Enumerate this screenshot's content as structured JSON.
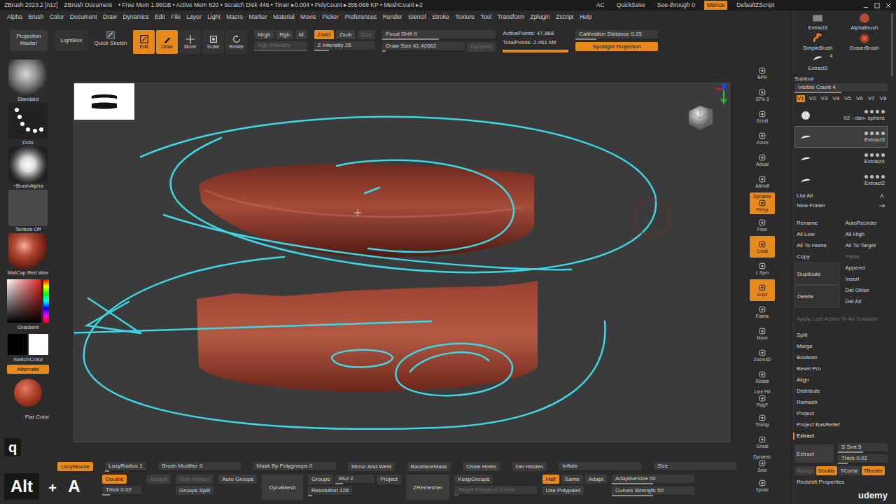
{
  "title_bar": {
    "app": "ZBrush 2023.2 [n1z]",
    "document": "ZBrush Document",
    "stats": "• Free Mem 1.96GB • Active Mem 620 • Scratch Disk 446 • Timer ▸0.004 • PolyCount ▸355.068 KP • MeshCount ▸2",
    "right": [
      {
        "label": "AC",
        "on": false
      },
      {
        "label": "QuickSave",
        "on": false
      },
      {
        "label": "See-through 0",
        "on": false
      },
      {
        "label": "Menus",
        "on": true
      },
      {
        "label": "DefaultZScript",
        "on": false
      }
    ]
  },
  "menu": [
    "Alpha",
    "Brush",
    "Color",
    "Document",
    "Draw",
    "Dynamics",
    "Edit",
    "File",
    "Layer",
    "Light",
    "Macro",
    "Marker",
    "Material",
    "Movie",
    "Picker",
    "Preferences",
    "Render",
    "Stencil",
    "Stroke",
    "Texture",
    "Tool",
    "Transform",
    "Zplugin",
    "Zscript",
    "Help"
  ],
  "top_shelf": {
    "projection_master": "Projection Master",
    "lightbox": "LightBox",
    "quick_sketch": "Quick Sketch",
    "modes": [
      {
        "label": "Edit",
        "on": true
      },
      {
        "label": "Draw",
        "on": true
      },
      {
        "label": "Move",
        "on": false
      },
      {
        "label": "Scale",
        "on": false
      },
      {
        "label": "Rotate",
        "on": false
      }
    ],
    "color_modes": [
      {
        "label": "Mrgb",
        "on": false
      },
      {
        "label": "Rgb",
        "on": false
      },
      {
        "label": "M",
        "on": false
      }
    ],
    "rgb_intensity": {
      "label": "Rgb Intensity",
      "level": 1,
      "disabled": true
    },
    "z_modes": [
      {
        "label": "Zadd",
        "on": true,
        "disabled": false
      },
      {
        "label": "Zsub",
        "on": false,
        "disabled": false
      },
      {
        "label": "Zcut",
        "on": false,
        "disabled": true
      }
    ],
    "z_intensity": {
      "label": "Z Intensity 25",
      "level": 0.25
    },
    "focal_shift": {
      "label": "Focal Shift 0",
      "level": 0.5
    },
    "draw_size": {
      "label": "Draw Size 41.42062",
      "level": 0.04
    },
    "dynamic": {
      "label": "Dynamic",
      "disabled": true
    },
    "active_points": "ActivePoints: 47,868",
    "total_points": "TotalPoints: 2.461 Mil",
    "progress": {
      "level": 1
    },
    "calibration": {
      "label": "Calibration Distance 0.25",
      "level": 0.25
    },
    "spotlight": {
      "label": "Spotlight Projection",
      "on": true
    }
  },
  "left_shelf": {
    "brush": "Standard",
    "stroke": "Dots",
    "alpha": "~BrushAlpha",
    "texture": "Texture Off",
    "material": "MatCap Red Wax",
    "gradient": "Gradient",
    "switch_color": "SwitchColor",
    "alternate": {
      "label": "Alternate",
      "on": true
    },
    "flat_color": "Flat Color"
  },
  "right_shelf": [
    {
      "label": "BPR",
      "on": false
    },
    {
      "label": "SPix 3",
      "on": false
    },
    {
      "label": "Scroll",
      "on": false
    },
    {
      "label": "Zoom",
      "on": false
    },
    {
      "label": "Actual",
      "on": false
    },
    {
      "label": "AAHalf",
      "on": false
    },
    {
      "label": "Persp",
      "on": true,
      "caption": "Dynamic"
    },
    {
      "label": "Floor",
      "on": false
    },
    {
      "label": "Local",
      "on": true
    },
    {
      "label": "L.Sym",
      "on": false
    },
    {
      "label": "Gxyz",
      "on": true
    },
    {
      "label": "Frame",
      "on": false
    },
    {
      "label": "Move",
      "on": false
    },
    {
      "label": "Zoom3D",
      "on": false
    },
    {
      "label": "Rotate",
      "on": false
    },
    {
      "label": "PolyF",
      "on": false,
      "caption": "Line Fill"
    },
    {
      "label": "Transp",
      "on": false
    },
    {
      "label": "Ghost",
      "on": false
    },
    {
      "label": "Solo",
      "on": false,
      "caption": "Dynamic"
    },
    {
      "label": "Xpose",
      "on": false
    }
  ],
  "tray": {
    "brushes": [
      {
        "label": "Extract3"
      },
      {
        "label": "AlphaBrush"
      },
      {
        "label": "SimpleBrush"
      },
      {
        "label": "EraserBrush"
      },
      {
        "label": "Extract3",
        "count": "4"
      }
    ],
    "subtool": {
      "title": "Subtool",
      "visible_count": {
        "label": "Visible Count 4",
        "level": 0.5
      },
      "versions": [
        {
          "label": "V1",
          "selected": true
        },
        {
          "label": "V2",
          "selected": false
        },
        {
          "label": "V3",
          "selected": false
        },
        {
          "label": "V4",
          "selected": false
        },
        {
          "label": "V5",
          "selected": false
        },
        {
          "label": "V6",
          "selected": false
        },
        {
          "label": "V7",
          "selected": false
        },
        {
          "label": "V8",
          "selected": false
        }
      ],
      "items": [
        {
          "name": "02 - dan- sphere",
          "selected": false
        },
        {
          "name": "Extract3",
          "selected": true
        },
        {
          "name": "Extract4",
          "selected": false
        },
        {
          "name": "Extract2",
          "selected": false
        }
      ],
      "list_all": "List All",
      "new_folder": "New Folder",
      "actions_left": [
        {
          "label": "Rename",
          "disabled": false
        },
        {
          "label": "All Low",
          "disabled": false
        },
        {
          "label": "All To Home",
          "disabled": false
        },
        {
          "label": "Copy",
          "disabled": false
        },
        {
          "label": "Duplicate",
          "disabled": false
        },
        {
          "label": "Delete",
          "disabled": false
        }
      ],
      "actions_right": [
        {
          "label": "AutoReorder",
          "disabled": false
        },
        {
          "label": "All High",
          "disabled": false
        },
        {
          "label": "All To Target",
          "disabled": false
        },
        {
          "label": "Paste",
          "disabled": true
        },
        {
          "label": "Append",
          "disabled": false
        },
        {
          "label": "Insert",
          "disabled": false
        },
        {
          "label": "Del Other",
          "disabled": false
        },
        {
          "label": "Del All",
          "disabled": false
        }
      ],
      "apply_all": {
        "label": "Apply Last Action To All Subtools",
        "disabled": true
      },
      "sections": [
        {
          "label": "Split",
          "expanded": false
        },
        {
          "label": "Merge",
          "expanded": false
        },
        {
          "label": "Boolean",
          "expanded": false
        },
        {
          "label": "Bevel Pro",
          "expanded": false
        },
        {
          "label": "Align",
          "expanded": false
        },
        {
          "label": "Distribute",
          "expanded": false
        },
        {
          "label": "Remesh",
          "expanded": false
        },
        {
          "label": "Project",
          "expanded": false
        },
        {
          "label": "Project BasRelief",
          "expanded": false
        },
        {
          "label": "Extract",
          "expanded": true
        }
      ],
      "extract": {
        "button": {
          "label": "Extract"
        },
        "smooth": {
          "label": "S Smt 5",
          "level": 0.5
        },
        "thick": {
          "label": "Thick 0.02",
          "level": 0.2
        },
        "toggles": [
          {
            "label": "Accept",
            "on": false,
            "disabled": true
          },
          {
            "label": "Double",
            "on": true,
            "disabled": false
          },
          {
            "label": "TCorne",
            "on": false,
            "disabled": false
          },
          {
            "label": "TBorder",
            "on": true,
            "disabled": false
          }
        ]
      },
      "redshift": "Redshift Properties"
    }
  },
  "bottom_shelf": {
    "row1": [
      {
        "label": "LazyMouse",
        "kind": "toggle",
        "on": true,
        "disabled": false
      },
      {
        "label": "LazyRadius 1",
        "kind": "slider",
        "level": 0.1,
        "disabled": false
      },
      {
        "label": "Brush Modifier 0",
        "kind": "slider",
        "level": 0,
        "disabled": false
      },
      {
        "label": "Mask By Polygroups 0",
        "kind": "slider",
        "level": 0,
        "disabled": false
      },
      {
        "label": "Mirror And Weld",
        "kind": "button",
        "disabled": false
      },
      {
        "label": "BackfaceMask",
        "kind": "button",
        "disabled": false
      },
      {
        "label": "Close Holes",
        "kind": "button",
        "disabled": false
      },
      {
        "label": "Del Hidden",
        "kind": "button",
        "disabled": false
      },
      {
        "label": "Inflate",
        "kind": "slider",
        "level": 0,
        "disabled": false
      },
      {
        "label": "Size",
        "kind": "slider",
        "level": 0,
        "disabled": false
      }
    ],
    "stacks": [
      [
        [
          {
            "label": "Double",
            "kind": "toggle",
            "on": true,
            "disabled": false
          }
        ],
        [
          {
            "label": "Thick 0.02",
            "kind": "slider",
            "level": 0.2,
            "disabled": false
          }
        ]
      ],
      [
        [
          {
            "label": "Accept",
            "kind": "button",
            "disabled": true
          }
        ]
      ],
      [
        [
          {
            "label": "Split Hidden",
            "kind": "button",
            "disabled": true
          }
        ],
        [
          {
            "label": "Groups Split",
            "kind": "button",
            "disabled": false
          }
        ]
      ],
      [
        [
          {
            "label": "Auto Groups",
            "kind": "button",
            "disabled": false
          }
        ]
      ],
      [
        [
          {
            "label": "DynaMesh",
            "kind": "big",
            "disabled": false
          }
        ]
      ],
      [
        [
          {
            "label": "Groups",
            "kind": "button",
            "disabled": false
          },
          {
            "label": "Blur 2",
            "kind": "slider",
            "level": 0.2,
            "disabled": false
          },
          {
            "label": "Project",
            "kind": "button",
            "disabled": false
          }
        ],
        [
          {
            "label": "Resolution 128",
            "kind": "slider",
            "level": 0.1,
            "disabled": false
          }
        ]
      ],
      [
        [
          {
            "label": "ZRemesher",
            "kind": "big",
            "disabled": false
          }
        ]
      ],
      [
        [
          {
            "label": "KeepGroups",
            "kind": "toggle",
            "on": false,
            "disabled": false
          }
        ],
        [
          {
            "label": "Target Polygons Count",
            "kind": "slider",
            "level": 0.05,
            "disabled": true
          }
        ]
      ],
      [
        [
          {
            "label": "Half",
            "kind": "toggle",
            "on": true,
            "disabled": false
          },
          {
            "label": "Same",
            "kind": "toggle",
            "on": false,
            "disabled": false
          },
          {
            "label": "Adapt",
            "kind": "toggle",
            "on": false,
            "disabled": false
          }
        ],
        [
          {
            "label": "Use Polypaint",
            "kind": "toggle",
            "on": false,
            "disabled": false
          }
        ]
      ],
      [
        [
          {
            "label": "AdaptiveSize 50",
            "kind": "slider",
            "level": 0.5,
            "disabled": false
          }
        ],
        [
          {
            "label": "Curves Strength 50",
            "kind": "slider",
            "level": 0.5,
            "disabled": false
          }
        ]
      ]
    ]
  },
  "overlays": {
    "keys": [
      {
        "label": "q"
      },
      {
        "label": "Alt"
      },
      {
        "label": "+"
      },
      {
        "label": "A"
      }
    ],
    "watermark": "udemy"
  }
}
